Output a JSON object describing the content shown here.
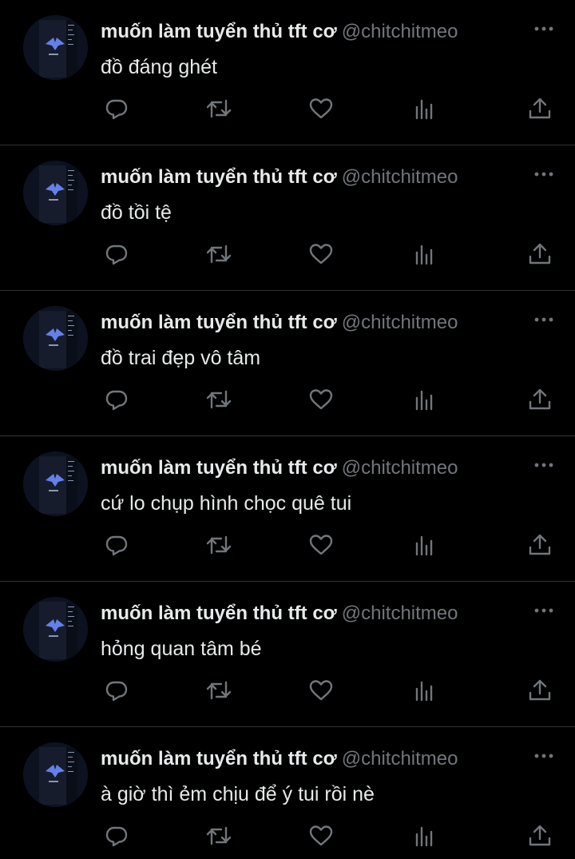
{
  "colors": {
    "background": "#000000",
    "text_primary": "#e7e9ea",
    "text_secondary": "#71767b",
    "divider": "#2f3336"
  },
  "icons": {
    "avatar": "avatar-image",
    "more": "more-dots-icon",
    "reply": "reply-icon",
    "retweet": "retweet-icon",
    "like": "heart-icon",
    "views": "views-chart-icon",
    "share": "share-icon"
  },
  "tweets": [
    {
      "name": "muốn làm tuyển thủ tft cơ",
      "handle": "@chitchitmeo",
      "text": "đồ đáng ghét"
    },
    {
      "name": "muốn làm tuyển thủ tft cơ",
      "handle": "@chitchitmeo",
      "text": "đồ tồi tệ"
    },
    {
      "name": "muốn làm tuyển thủ tft cơ",
      "handle": "@chitchitmeo",
      "text": "đồ trai đẹp vô tâm"
    },
    {
      "name": "muốn làm tuyển thủ tft cơ",
      "handle": "@chitchitmeo",
      "text": "cứ lo chụp hình chọc quê tui"
    },
    {
      "name": "muốn làm tuyển thủ tft cơ",
      "handle": "@chitchitmeo",
      "text": "hỏng quan tâm bé"
    },
    {
      "name": "muốn làm tuyển thủ tft cơ",
      "handle": "@chitchitmeo",
      "text": "à giờ thì ẻm chịu để ý tui rồi nè"
    }
  ]
}
